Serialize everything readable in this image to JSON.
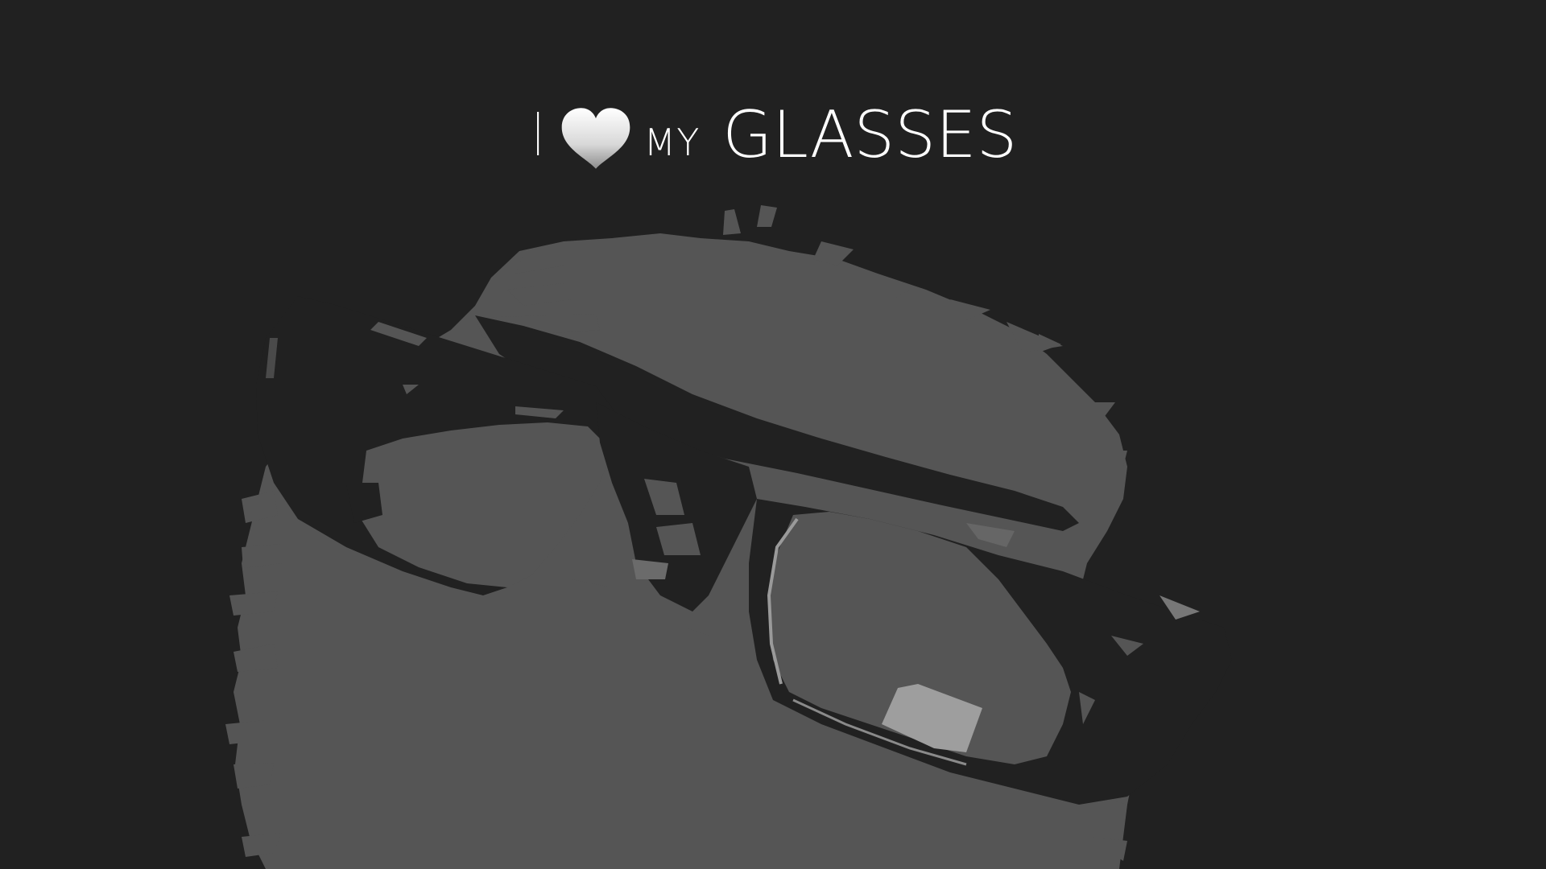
{
  "title": {
    "word_i": "I",
    "heart_icon": "heart-icon",
    "word_my": "MY",
    "word_glasses": "GLASSES"
  },
  "colors": {
    "background": "#212121",
    "paint": "#555555",
    "highlight": "#9a9a9a",
    "text": "#ffffff"
  }
}
